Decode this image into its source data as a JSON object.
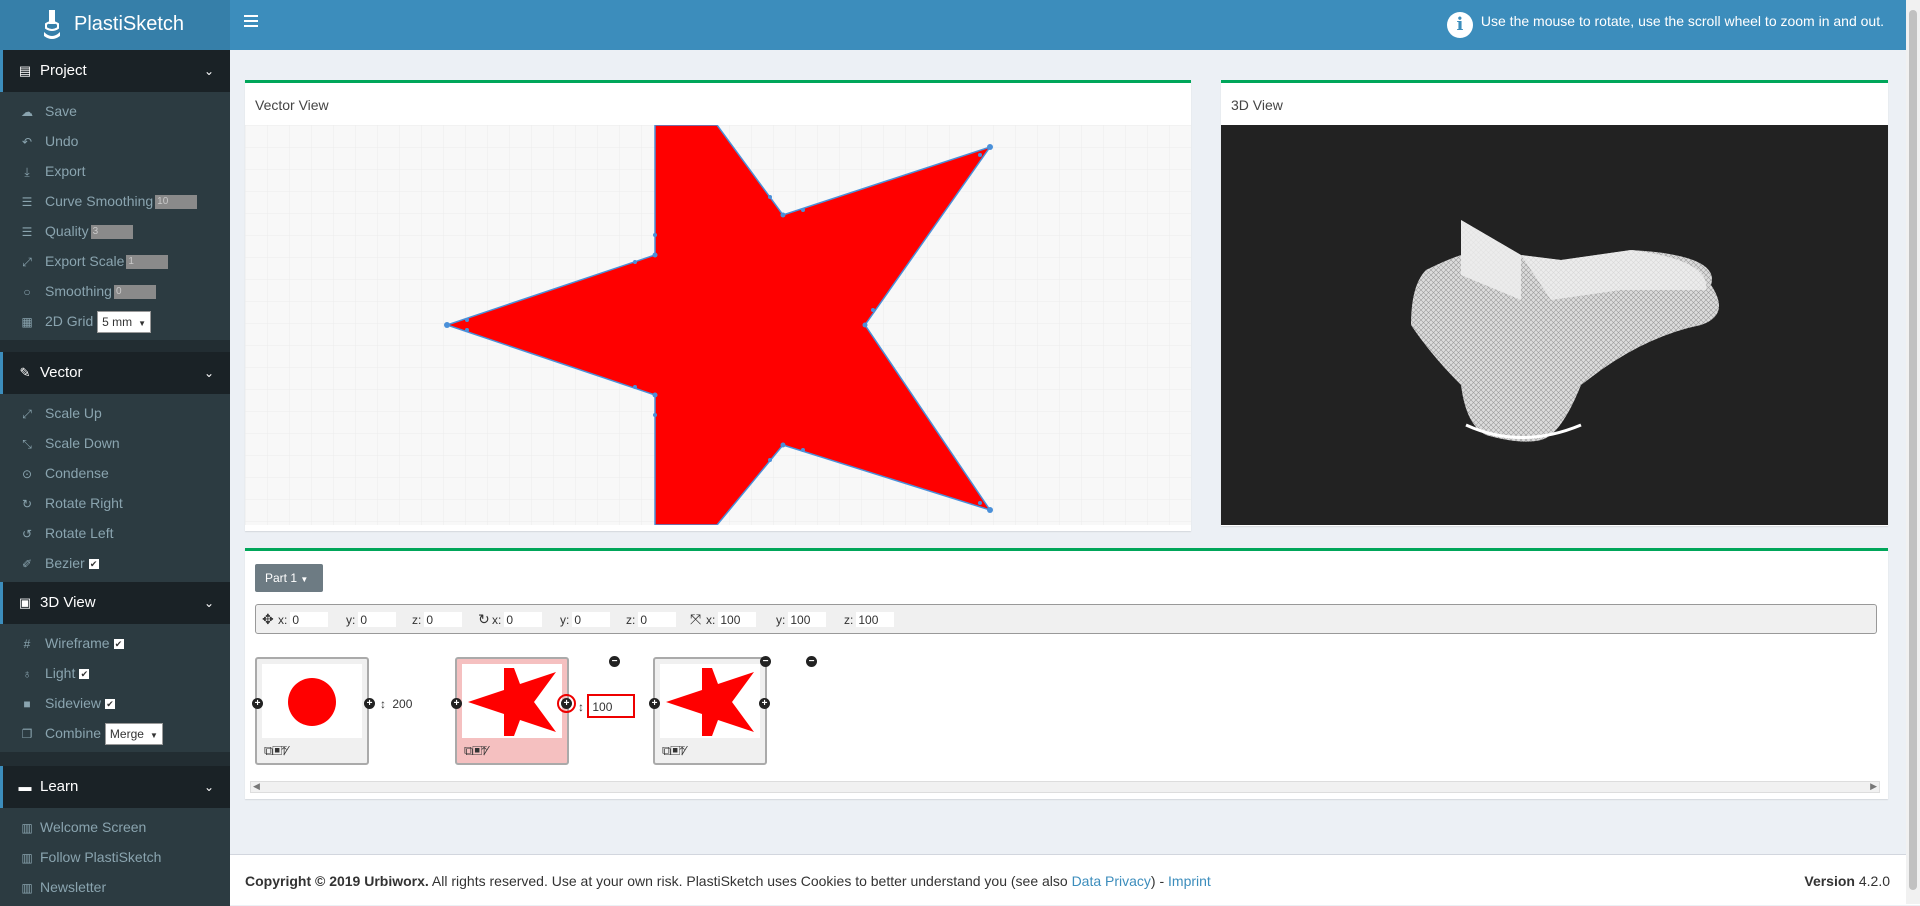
{
  "header": {
    "app_name": "PlastiSketch",
    "hint": "Use the mouse to rotate, use the scroll wheel to zoom in and out."
  },
  "sidebar": {
    "project": {
      "title": "Project",
      "items": {
        "save": "Save",
        "undo": "Undo",
        "export": "Export",
        "curve_smoothing": "Curve Smoothing",
        "curve_smoothing_value": "10",
        "quality": "Quality",
        "quality_value": "3",
        "export_scale": "Export Scale",
        "export_scale_value": "1",
        "smoothing": "Smoothing",
        "smoothing_value": "0",
        "grid": "2D Grid",
        "grid_value": "5 mm"
      }
    },
    "vector": {
      "title": "Vector",
      "items": {
        "scale_up": "Scale Up",
        "scale_down": "Scale Down",
        "condense": "Condense",
        "rotate_right": "Rotate Right",
        "rotate_left": "Rotate Left",
        "bezier": "Bezier"
      }
    },
    "view3d": {
      "title": "3D View",
      "items": {
        "wireframe": "Wireframe",
        "light": "Light",
        "sideview": "Sideview",
        "combine": "Combine",
        "combine_value": "Merge"
      }
    },
    "learn": {
      "title": "Learn",
      "items": {
        "welcome": "Welcome Screen",
        "follow": "Follow PlastiSketch",
        "newsletter": "Newsletter"
      }
    }
  },
  "vector_view": {
    "title": "Vector View"
  },
  "view_3d": {
    "title": "3D View"
  },
  "parts": {
    "part_label": "Part 1",
    "position": {
      "x_label": "x:",
      "x": "0",
      "y_label": "y:",
      "y": "0",
      "z_label": "z:",
      "z": "0"
    },
    "rotation": {
      "x_label": "x:",
      "x": "0",
      "y_label": "y:",
      "y": "0",
      "z_label": "z:",
      "z": "0"
    },
    "scale": {
      "x_label": "x:",
      "x": "100",
      "y_label": "y:",
      "y": "100",
      "z_label": "z:",
      "z": "100"
    },
    "gap1": "200",
    "gap2": "100"
  },
  "footer": {
    "copyright": "Copyright © 2019 Urbiworx.",
    "text": " All rights reserved. Use at your own risk. PlastiSketch uses Cookies to better understand you (see also ",
    "privacy": "Data Privacy",
    "after_privacy": ") - ",
    "imprint": "Imprint",
    "version_label": "Version",
    "version": "4.2.0"
  },
  "colors": {
    "shape": "#ff0000",
    "header": "#3c8dbc",
    "sidebar": "#222d32",
    "accent_box": "#00a65a"
  }
}
